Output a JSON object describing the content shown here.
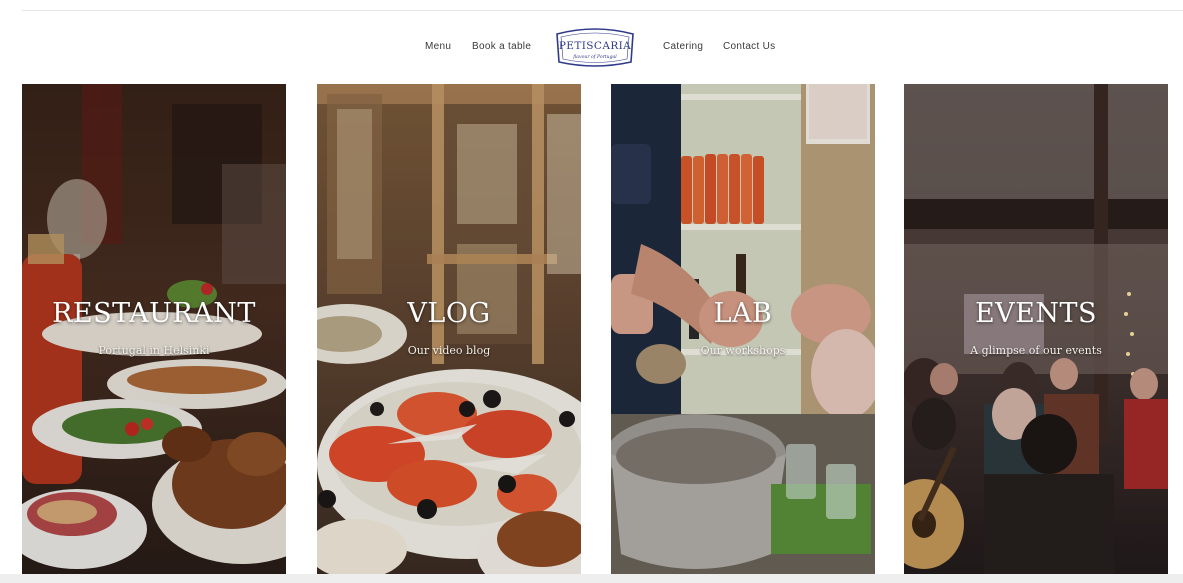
{
  "nav": {
    "left_links": [
      {
        "label": "Menu"
      },
      {
        "label": "Book a table"
      }
    ],
    "right_links": [
      {
        "label": "Catering"
      },
      {
        "label": "Contact Us"
      }
    ],
    "logo": {
      "name": "PETISCARIA",
      "tagline": "flavour of Portugal",
      "color": "#2f3a8a"
    }
  },
  "cards": [
    {
      "title": "RESTAURANT",
      "subtitle": "Portugal in Helsinki"
    },
    {
      "title": "VLOG",
      "subtitle": "Our video blog"
    },
    {
      "title": "LAB",
      "subtitle": "Our workshops"
    },
    {
      "title": "EVENTS",
      "subtitle": "A glimpse of our events"
    }
  ]
}
